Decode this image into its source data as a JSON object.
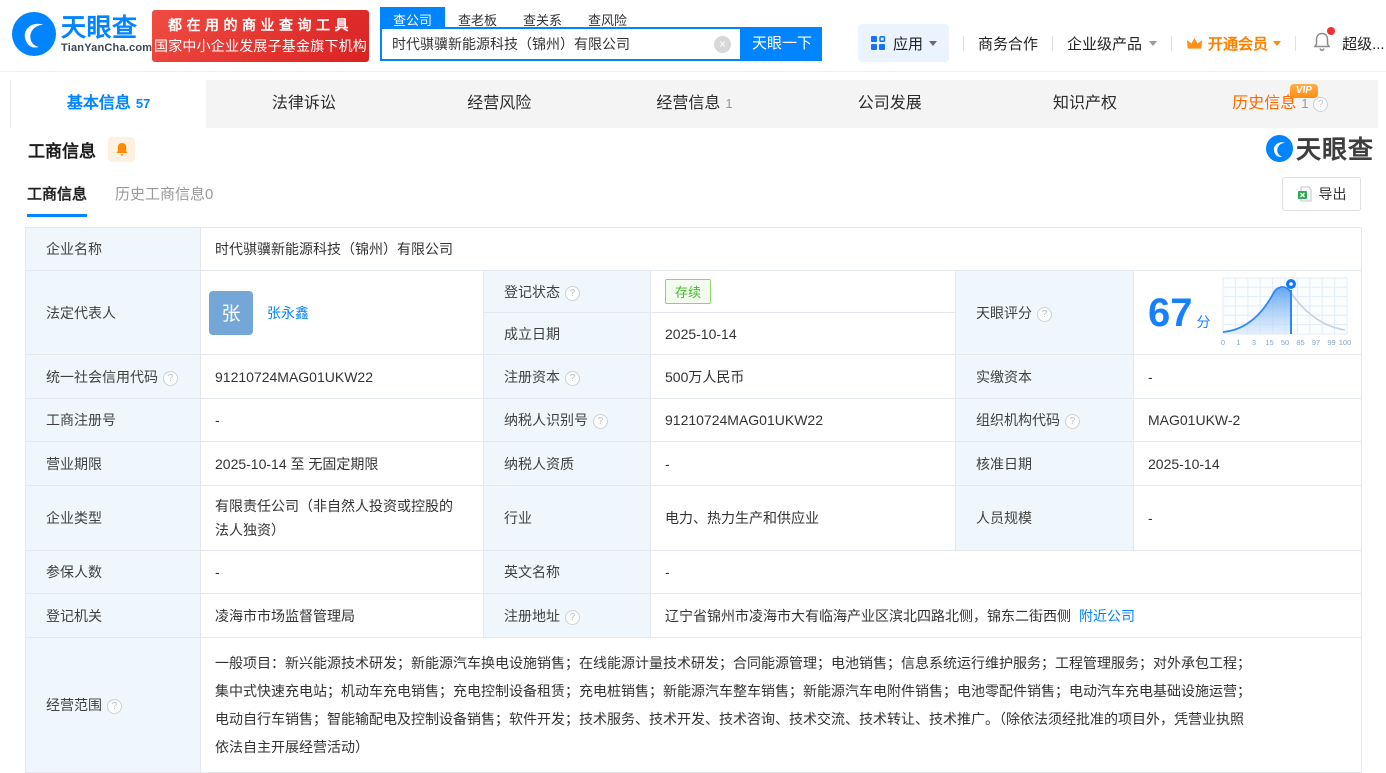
{
  "header": {
    "brand": "天眼查",
    "brand_domain": "TianYanCha.com",
    "slogan_line1": "都在用的商业查询工具",
    "slogan_line2": "国家中小企业发展子基金旗下机构",
    "search_tabs": [
      {
        "label": "查公司"
      },
      {
        "label": "查老板"
      },
      {
        "label": "查关系"
      },
      {
        "label": "查风险"
      }
    ],
    "search_value": "时代骐骥新能源科技（锦州）有限公司",
    "search_button": "天眼一下",
    "menu_apps": "应用",
    "menu_biz": "商务合作",
    "menu_enterprise": "企业级产品",
    "menu_vip": "开通会员",
    "menu_super": "超级..."
  },
  "nav_tabs": [
    {
      "label": "基本信息",
      "count": "57"
    },
    {
      "label": "法律诉讼",
      "count": ""
    },
    {
      "label": "经营风险",
      "count": ""
    },
    {
      "label": "经营信息",
      "count": "1"
    },
    {
      "label": "公司发展",
      "count": ""
    },
    {
      "label": "知识产权",
      "count": ""
    },
    {
      "label": "历史信息",
      "count": "1",
      "vip": "VIP"
    }
  ],
  "section_title": "工商信息",
  "watermark": "天眼查",
  "subtabs": [
    {
      "label": "工商信息"
    },
    {
      "label": "历史工商信息0"
    }
  ],
  "export_label": "导出",
  "fields": {
    "company_name_label": "企业名称",
    "company_name": "时代骐骥新能源科技（锦州）有限公司",
    "legal_rep_label": "法定代表人",
    "legal_rep_avatar": "张",
    "legal_rep_name": "张永鑫",
    "reg_status_label": "登记状态",
    "reg_status": "存续",
    "establish_date_label": "成立日期",
    "establish_date": "2025-10-14",
    "score_label": "天眼评分",
    "score": "67",
    "score_unit": "分",
    "credit_code_label": "统一社会信用代码",
    "credit_code": "91210724MAG01UKW22",
    "reg_capital_label": "注册资本",
    "reg_capital": "500万人民币",
    "paid_capital_label": "实缴资本",
    "paid_capital": "-",
    "reg_number_label": "工商注册号",
    "reg_number": "-",
    "taxpayer_id_label": "纳税人识别号",
    "taxpayer_id": "91210724MAG01UKW22",
    "org_code_label": "组织机构代码",
    "org_code": "MAG01UKW-2",
    "business_term_label": "营业期限",
    "business_term": "2025-10-14 至 无固定期限",
    "taxpayer_quality_label": "纳税人资质",
    "taxpayer_quality": "-",
    "approve_date_label": "核准日期",
    "approve_date": "2025-10-14",
    "company_type_label": "企业类型",
    "company_type": "有限责任公司（非自然人投资或控股的法人独资）",
    "industry_label": "行业",
    "industry": "电力、热力生产和供应业",
    "staff_size_label": "人员规模",
    "staff_size": "-",
    "insured_label": "参保人数",
    "insured": "-",
    "english_name_label": "英文名称",
    "english_name": "-",
    "reg_authority_label": "登记机关",
    "reg_authority": "凌海市市场监督管理局",
    "reg_address_label": "注册地址",
    "reg_address": "辽宁省锦州市凌海市大有临海产业区滨北四路北侧，锦东二街西侧",
    "nearby_link": "附近公司",
    "business_scope_label": "经营范围",
    "business_scope": "一般项目：新兴能源技术研发；新能源汽车换电设施销售；在线能源计量技术研发；合同能源管理；电池销售；信息系统运行维护服务；工程管理服务；对外承包工程；集中式快速充电站；机动车充电销售；充电控制设备租赁；充电桩销售；新能源汽车整车销售；新能源汽车电附件销售；电池零配件销售；电动汽车充电基础设施运营；电动自行车销售；智能输配电及控制设备销售；软件开发；技术服务、技术开发、技术咨询、技术交流、技术转让、技术推广。（除依法须经批准的项目外，凭营业执照依法自主开展经营活动）"
  },
  "score_chart": {
    "type": "area",
    "x_labels": [
      "0",
      "1",
      "3",
      "15",
      "50",
      "85",
      "97",
      "99",
      "100"
    ],
    "score_value": 67
  }
}
